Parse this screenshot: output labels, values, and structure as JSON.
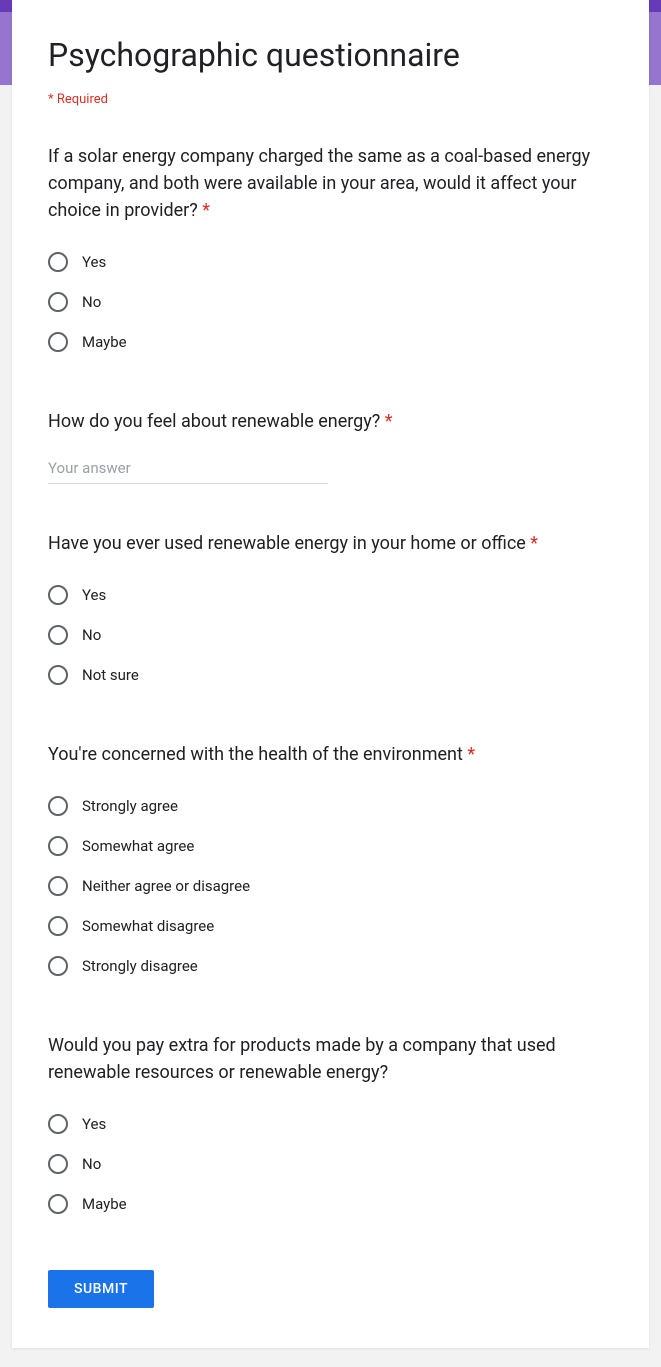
{
  "form": {
    "title": "Psychographic questionnaire",
    "required_note": "* Required",
    "submit_label": "SUBMIT"
  },
  "questions": [
    {
      "text": "If a solar energy company charged the same as a coal-based energy company, and both were available in your area, would it affect your choice in provider? ",
      "required": true,
      "type": "radio",
      "options": [
        "Yes",
        "No",
        "Maybe"
      ]
    },
    {
      "text": "How do you feel about renewable energy? ",
      "required": true,
      "type": "text",
      "placeholder": "Your answer"
    },
    {
      "text": "Have you ever used renewable energy in your home or office ",
      "required": true,
      "type": "radio",
      "options": [
        "Yes",
        "No",
        "Not sure"
      ]
    },
    {
      "text": "You're concerned with the health of the environment ",
      "required": true,
      "type": "radio",
      "options": [
        "Strongly agree",
        "Somewhat agree",
        "Neither agree or disagree",
        "Somewhat disagree",
        "Strongly disagree"
      ]
    },
    {
      "text": "Would you pay extra for products made by a company that used renewable resources or renewable energy?",
      "required": false,
      "type": "radio",
      "options": [
        "Yes",
        "No",
        "Maybe"
      ]
    }
  ]
}
